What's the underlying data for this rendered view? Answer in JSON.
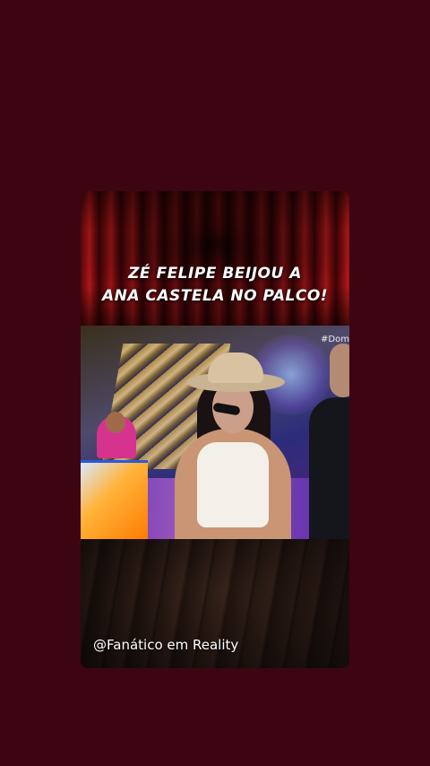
{
  "post": {
    "headline_line1": "ZÉ FELIPE BEIJOU A",
    "headline_line2": "ANA CASTELA NO PALCO!",
    "video_hashtag": "#Domi",
    "watermark": "@Fanático em Reality"
  },
  "colors": {
    "page_background": "#3d0512",
    "curtain_red": "#b1181b",
    "text": "#ffffff"
  }
}
